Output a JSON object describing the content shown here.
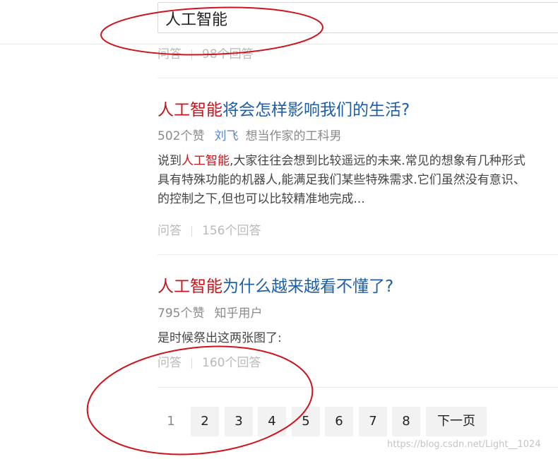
{
  "search": {
    "query": "人工智能"
  },
  "prev_item": {
    "type": "问答",
    "answers": "98个回答"
  },
  "results": [
    {
      "title_highlight": "人工智能",
      "title_rest": "将会怎样影响我们的生活?",
      "votes": "502个赞",
      "author": "刘飞",
      "author_bio": "想当作家的工科男",
      "excerpt_line1_pre": "说到",
      "excerpt_line1_hl": "人工智能",
      "excerpt_line1_post": ",大家往往会想到比较遥远的未来.常见的想象有几种形式",
      "excerpt_line2": "具有特殊功能的机器人,能满足我们某些特殊需求.它们虽然没有意识、",
      "excerpt_line3": "的控制之下,但也可以比较精准地完成...",
      "type": "问答",
      "answers": "156个回答"
    },
    {
      "title_highlight": "人工智能",
      "title_rest": "为什么越来越看不懂了?",
      "votes": "795个赞",
      "author": "知乎用户",
      "excerpt": "是时候祭出这两张图了:",
      "type": "问答",
      "answers": "160个回答"
    }
  ],
  "pagination": {
    "current": "1",
    "pages": [
      "2",
      "3",
      "4",
      "5",
      "6",
      "7",
      "8"
    ],
    "next": "下一页"
  },
  "watermark": "https://blog.csdn.net/Light__1024",
  "colors": {
    "title": "#1f5fa8",
    "highlight": "#c4161c",
    "annotation": "#d0121b"
  }
}
